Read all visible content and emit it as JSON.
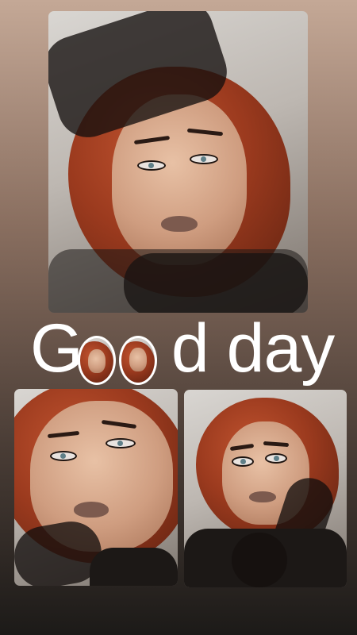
{
  "story": {
    "headline_part1": "G",
    "headline_part2": "d day",
    "photos": [
      {
        "name": "main-portrait",
        "icon": "portrait-image"
      },
      {
        "name": "bottom-left-portrait",
        "icon": "portrait-image"
      },
      {
        "name": "bottom-right-portrait",
        "icon": "portrait-image"
      }
    ],
    "colors": {
      "text": "#ffffff",
      "hair": "#9b3a1e",
      "background_top": "#c4a896",
      "background_bottom": "#1c1a18"
    }
  }
}
